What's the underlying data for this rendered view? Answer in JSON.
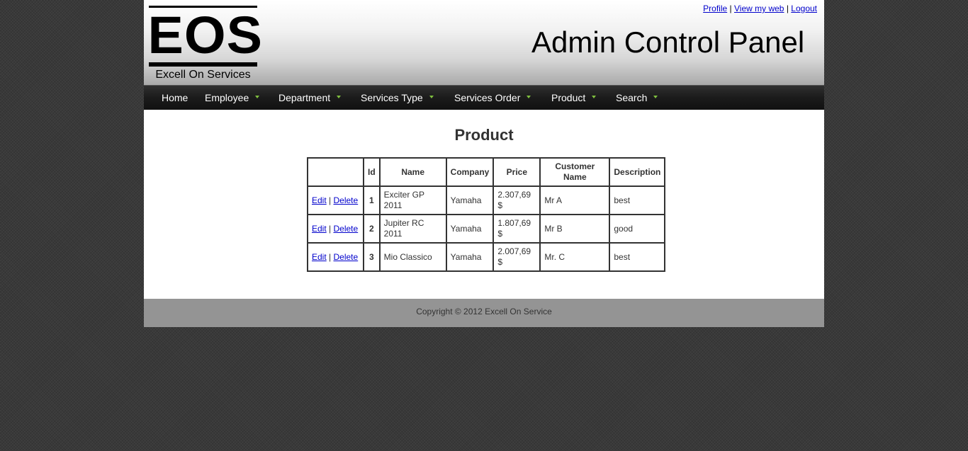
{
  "header": {
    "logo_text": "EOS",
    "logo_tagline": "Excell On Services",
    "title": "Admin Control Panel",
    "links": {
      "profile": "Profile",
      "view_web": "View my web",
      "logout": "Logout",
      "separator": "|"
    }
  },
  "nav": {
    "items": [
      {
        "label": "Home",
        "has_dropdown": false
      },
      {
        "label": "Employee",
        "has_dropdown": true
      },
      {
        "label": "Department",
        "has_dropdown": true
      },
      {
        "label": "Services Type",
        "has_dropdown": true
      },
      {
        "label": "Services Order",
        "has_dropdown": true
      },
      {
        "label": "Product",
        "has_dropdown": true
      },
      {
        "label": "Search",
        "has_dropdown": true
      }
    ],
    "caret_color": "#7fbf3f"
  },
  "main": {
    "heading": "Product",
    "table": {
      "headers": [
        "",
        "Id",
        "Name",
        "Company",
        "Price",
        "Customer Name",
        "Description"
      ],
      "action_labels": {
        "edit": "Edit",
        "delete": "Delete",
        "separator": "|"
      },
      "rows": [
        {
          "id": "1",
          "name": "Exciter GP 2011",
          "company": "Yamaha",
          "price": "2.307,69 $",
          "customer": "Mr A",
          "description": "best"
        },
        {
          "id": "2",
          "name": "Jupiter RC 2011",
          "company": "Yamaha",
          "price": "1.807,69 $",
          "customer": "Mr B",
          "description": "good"
        },
        {
          "id": "3",
          "name": "Mio Classico",
          "company": "Yamaha",
          "price": "2.007,69 $",
          "customer": "Mr. C",
          "description": "best"
        }
      ]
    }
  },
  "footer": {
    "copyright": "Copyright © 2012 Excell On Service"
  }
}
